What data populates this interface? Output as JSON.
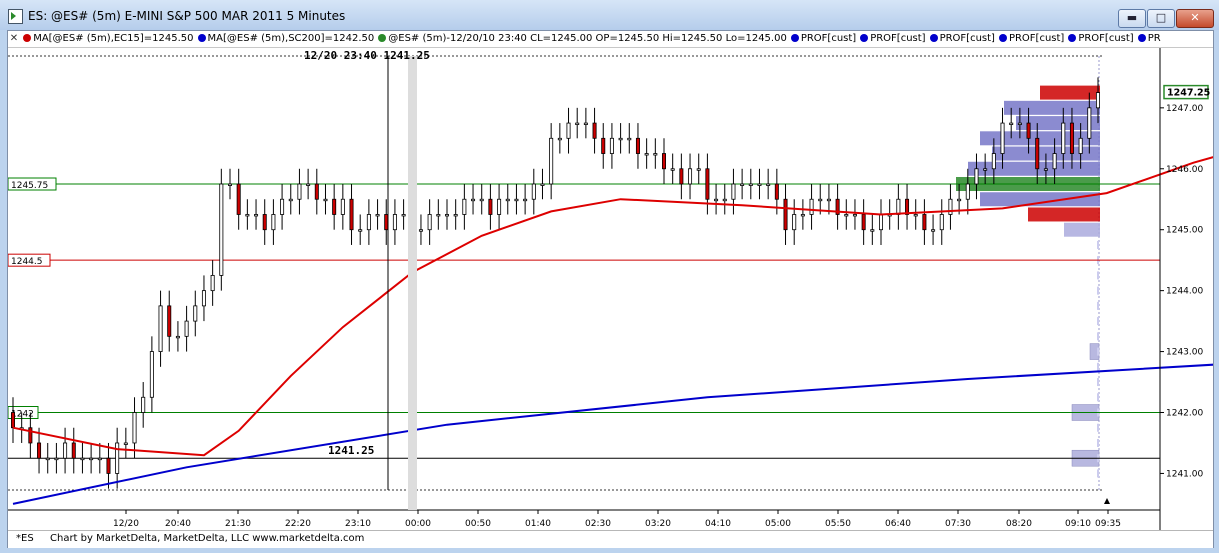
{
  "window": {
    "title": "ES: @ES# (5m) E-MINI S&P 500 MAR 2011 5 Minutes",
    "buttons": {
      "minimize": "▬",
      "maximize": "□",
      "close": "✕"
    }
  },
  "studies": [
    {
      "label": "MA[@ES# (5m),EC15]=1245.50",
      "color": "#cc0000"
    },
    {
      "label": "MA[@ES# (5m),SC200]=1242.50",
      "color": "#0000cc"
    },
    {
      "label": "@ES# (5m)-12/20/10 23:40 CL=1245.00 OP=1245.50 Hi=1245.50 Lo=1245.00",
      "color": "#2a8a2a"
    },
    {
      "label": "PROF[cust]",
      "color": "#0000cc"
    },
    {
      "label": "PROF[cust]",
      "color": "#0000cc"
    },
    {
      "label": "PROF[cust]",
      "color": "#0000cc"
    },
    {
      "label": "PROF[cust]",
      "color": "#0000cc"
    },
    {
      "label": "PROF[cust]",
      "color": "#0000cc"
    },
    {
      "label": "PR",
      "color": "#0000cc"
    }
  ],
  "footer": {
    "symbol": "*ES",
    "credit": "Chart by MarketDelta, MarketDelta, LLC www.marketdelta.com"
  },
  "chart_data": {
    "type": "candlestick",
    "ylim": [
      1240.4,
      1247.9
    ],
    "yticks": [
      1241.0,
      1242.0,
      1243.0,
      1244.0,
      1245.0,
      1246.0,
      1247.0
    ],
    "ytick_labels": [
      "1241.00",
      "1242.00",
      "1243.00",
      "1244.00",
      "1245.00",
      "1246.00",
      "1247.00"
    ],
    "xtick_labels": [
      "12/20",
      "20:40",
      "21:30",
      "22:20",
      "23:10",
      "00:00",
      "00:50",
      "01:40",
      "02:30",
      "03:20",
      "04:10",
      "05:00",
      "05:50",
      "06:40",
      "07:30",
      "08:20",
      "09:10",
      "09:35"
    ],
    "crosshair": {
      "label": "12/20 23:40",
      "price_label": "1241.25",
      "price": 1241.25
    },
    "last_price": 1247.25,
    "horizontal_lines": [
      {
        "price": 1245.75,
        "label": "1245.75",
        "color": "#008000"
      },
      {
        "price": 1244.5,
        "label": "1244.5",
        "color": "#cc0000"
      },
      {
        "price": 1242.0,
        "label": "1242",
        "color": "#008000"
      },
      {
        "price": 1241.25,
        "label": "1241.25",
        "color": "#000000"
      }
    ],
    "ohlc_closes": [
      1241.75,
      1241.75,
      1241.5,
      1241.25,
      1241.25,
      1241.25,
      1241.5,
      1241.25,
      1241.25,
      1241.25,
      1241.25,
      1241.0,
      1241.5,
      1241.5,
      1242.0,
      1242.25,
      1243.0,
      1243.75,
      1243.25,
      1243.25,
      1243.5,
      1243.75,
      1244.0,
      1244.25,
      1245.75,
      1245.75,
      1245.25,
      1245.25,
      1245.25,
      1245.0,
      1245.25,
      1245.5,
      1245.5,
      1245.75,
      1245.75,
      1245.5,
      1245.5,
      1245.25,
      1245.5,
      1245.0,
      1245.0,
      1245.25,
      1245.25,
      1245.0,
      1245.25,
      1245.25,
      1245.0,
      1245.0,
      1245.25,
      1245.25,
      1245.25,
      1245.25,
      1245.5,
      1245.5,
      1245.5,
      1245.25,
      1245.5,
      1245.5,
      1245.5,
      1245.5,
      1245.75,
      1245.75,
      1246.5,
      1246.5,
      1246.75,
      1246.75,
      1246.75,
      1246.5,
      1246.25,
      1246.5,
      1246.5,
      1246.5,
      1246.25,
      1246.25,
      1246.25,
      1246.0,
      1246.0,
      1245.75,
      1246.0,
      1246.0,
      1245.5,
      1245.5,
      1245.5,
      1245.75,
      1245.75,
      1245.75,
      1245.75,
      1245.75,
      1245.5,
      1245.0,
      1245.25,
      1245.25,
      1245.5,
      1245.5,
      1245.5,
      1245.25,
      1245.25,
      1245.25,
      1245.0,
      1245.0,
      1245.25,
      1245.25,
      1245.5,
      1245.25,
      1245.25,
      1245.0,
      1245.0,
      1245.25,
      1245.5,
      1245.5,
      1245.75,
      1246.0,
      1246.0,
      1246.25,
      1246.75,
      1246.75,
      1246.75,
      1246.5,
      1246.0,
      1246.0,
      1246.25,
      1246.75,
      1246.25,
      1246.5,
      1247.0,
      1247.25
    ],
    "ema15_points": [
      [
        0,
        1241.75
      ],
      [
        12,
        1241.4
      ],
      [
        22,
        1241.3
      ],
      [
        26,
        1241.7
      ],
      [
        32,
        1242.6
      ],
      [
        38,
        1243.4
      ],
      [
        46,
        1244.3
      ],
      [
        54,
        1244.9
      ],
      [
        62,
        1245.3
      ],
      [
        70,
        1245.5
      ],
      [
        84,
        1245.4
      ],
      [
        100,
        1245.25
      ],
      [
        114,
        1245.35
      ],
      [
        126,
        1245.6
      ],
      [
        136,
        1246.1
      ],
      [
        146,
        1246.5
      ],
      [
        156,
        1246.55
      ],
      [
        166,
        1246.35
      ],
      [
        180,
        1246.05
      ],
      [
        200,
        1245.8
      ],
      [
        218,
        1245.55
      ],
      [
        232,
        1245.35
      ],
      [
        244,
        1245.3
      ],
      [
        260,
        1245.35
      ],
      [
        270,
        1245.6
      ],
      [
        280,
        1246.0
      ],
      [
        289,
        1246.4
      ],
      [
        296,
        1246.6
      ]
    ],
    "sma200_points": [
      [
        0,
        1240.5
      ],
      [
        20,
        1241.1
      ],
      [
        50,
        1241.8
      ],
      [
        80,
        1242.25
      ],
      [
        110,
        1242.55
      ],
      [
        140,
        1242.8
      ],
      [
        170,
        1243.2
      ],
      [
        200,
        1243.7
      ],
      [
        220,
        1244.0
      ],
      [
        240,
        1244.2
      ],
      [
        260,
        1244.4
      ],
      [
        280,
        1244.55
      ],
      [
        296,
        1244.75
      ]
    ],
    "volume_profile": [
      {
        "price": 1247.25,
        "size": 5,
        "color": "#cc0000"
      },
      {
        "price": 1247.0,
        "size": 8,
        "color": "#7777c8"
      },
      {
        "price": 1246.75,
        "size": 7,
        "color": "#7777c8"
      },
      {
        "price": 1246.5,
        "size": 10,
        "color": "#7777c8"
      },
      {
        "price": 1246.25,
        "size": 9,
        "color": "#7777c8"
      },
      {
        "price": 1246.0,
        "size": 11,
        "color": "#7777c8"
      },
      {
        "price": 1245.75,
        "size": 12,
        "color": "#2a8a2a"
      },
      {
        "price": 1245.5,
        "size": 10,
        "color": "#7777c8"
      },
      {
        "price": 1245.25,
        "size": 6,
        "color": "#cc0000"
      },
      {
        "price": 1245.0,
        "size": 3,
        "color": "#aaaadd"
      }
    ],
    "session_profile": [
      {
        "price": 1242.0,
        "size": 3
      },
      {
        "price": 1241.25,
        "size": 3
      },
      {
        "price": 1243.0,
        "size": 1
      }
    ]
  }
}
